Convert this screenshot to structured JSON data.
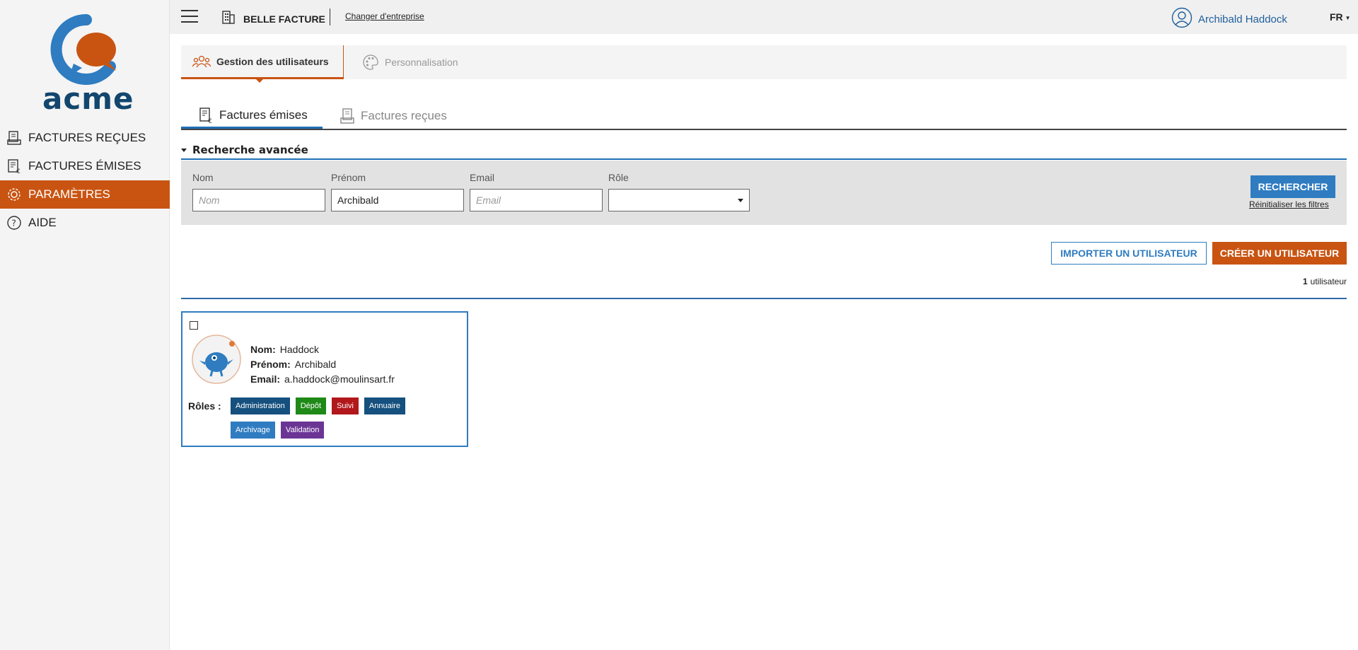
{
  "sidebar": {
    "logo_text": "acme",
    "items": [
      {
        "label": "FACTURES REÇUES",
        "icon": "received-invoices-icon"
      },
      {
        "label": "FACTURES ÉMISES",
        "icon": "issued-invoices-icon"
      },
      {
        "label": "PARAMÈTRES",
        "icon": "gear-icon"
      },
      {
        "label": "AIDE",
        "icon": "help-icon"
      }
    ],
    "active_index": 2
  },
  "topbar": {
    "company": "BELLE FACTURE",
    "change_company": "Changer d'entreprise",
    "user_name": "Archibald Haddock",
    "lang": "FR"
  },
  "main_tabs": [
    {
      "label": "Gestion des utilisateurs",
      "icon": "users-icon"
    },
    {
      "label": "Personnalisation",
      "icon": "palette-icon"
    }
  ],
  "sub_tabs": [
    {
      "label": "Factures émises",
      "icon": "issued-invoices-icon"
    },
    {
      "label": "Factures reçues",
      "icon": "received-invoices-icon"
    }
  ],
  "search": {
    "title": "Recherche avancée",
    "fields": {
      "nom": {
        "label": "Nom",
        "value": "",
        "placeholder": "Nom"
      },
      "prenom": {
        "label": "Prénom",
        "value": "Archibald",
        "placeholder": "Prénom"
      },
      "email": {
        "label": "Email",
        "value": "",
        "placeholder": "Email"
      },
      "role": {
        "label": "Rôle",
        "value": ""
      }
    },
    "search_button": "RECHERCHER",
    "reset_link": "Réinitialiser les filtres"
  },
  "actions": {
    "import": "IMPORTER UN UTILISATEUR",
    "create": "CRÉER UN UTILISATEUR"
  },
  "result_count": {
    "number": "1",
    "label": "utilisateur"
  },
  "users": [
    {
      "nom_label": "Nom:",
      "nom": "Haddock",
      "prenom_label": "Prénom:",
      "prenom": "Archibald",
      "email_label": "Email:",
      "email": "a.haddock@moulinsart.fr",
      "roles_label": "Rôles :",
      "roles": [
        {
          "label": "Administration",
          "color": "#15507e"
        },
        {
          "label": "Dépôt",
          "color": "#1f8a17"
        },
        {
          "label": "Suivi",
          "color": "#b1171b"
        },
        {
          "label": "Annuaire",
          "color": "#15507e"
        },
        {
          "label": "Archivage",
          "color": "#2f7cc1"
        },
        {
          "label": "Validation",
          "color": "#6b3595"
        }
      ]
    }
  ],
  "colors": {
    "accent": "#c95412",
    "primary": "#2f7cc1",
    "brand_dark": "#12466e"
  }
}
